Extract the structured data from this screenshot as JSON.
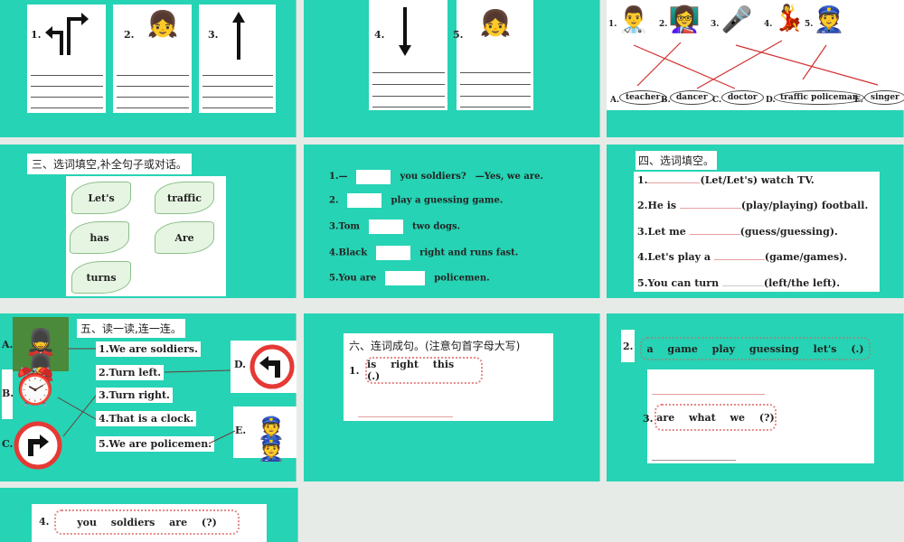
{
  "slide1": {
    "items": [
      {
        "num": "1.",
        "icon": "turn-arrows-icon"
      },
      {
        "num": "2.",
        "icon": "girl-waving-icon"
      },
      {
        "num": "3.",
        "icon": "up-arrow-icon"
      }
    ]
  },
  "slide2": {
    "items": [
      {
        "num": "4.",
        "icon": "down-arrow-icon"
      },
      {
        "num": "5.",
        "icon": "girl-waving-icon"
      }
    ]
  },
  "slide3": {
    "people": [
      "1.",
      "2.",
      "3.",
      "4.",
      "5."
    ],
    "words": [
      {
        "l": "A.",
        "w": "teacher"
      },
      {
        "l": "B.",
        "w": "dancer"
      },
      {
        "l": "C.",
        "w": "doctor"
      },
      {
        "l": "D.",
        "w": "traffic policeman"
      },
      {
        "l": "E.",
        "w": "singer"
      }
    ],
    "line_color": "#d32f2f"
  },
  "slide4": {
    "title": "三、选词填空,补全句子或对话。",
    "words": [
      "Let's",
      "traffic",
      "has",
      "Are",
      "turns"
    ]
  },
  "slide5": {
    "sentences": [
      {
        "pre": "1.—",
        "post": "you soldiers?　—Yes, we are."
      },
      {
        "pre": "2.",
        "post": "play a guessing game."
      },
      {
        "pre": "3.Tom",
        "post": "two dogs."
      },
      {
        "pre": "4.Black",
        "post": "right and runs fast."
      },
      {
        "pre": "5.You are",
        "post": "policemen."
      }
    ]
  },
  "slide6": {
    "title": "四、选词填空。",
    "sentences": [
      {
        "pre": "1.",
        "post": "(Let/Let's) watch TV."
      },
      {
        "pre": "2.He is",
        "post": "(play/playing) football."
      },
      {
        "pre": "3.Let me",
        "post": "(guess/guessing)."
      },
      {
        "pre": "4.Let's play a",
        "post": "(game/games)."
      },
      {
        "pre": "5.You can turn",
        "post": "(left/the left)."
      }
    ]
  },
  "slide7": {
    "title": "五、读一读,连一连。",
    "sentences": [
      "1.We are soldiers.",
      "2.Turn left.",
      "3.Turn right.",
      "4.That is a clock.",
      "5.We are policemen."
    ],
    "pics": [
      "A.",
      "B.",
      "C.",
      "D.",
      "E."
    ],
    "sign_color": "#e53935"
  },
  "slide8": {
    "title": "六、连词成句。(注意句首字母大写)",
    "q1_num": "1.",
    "q1": "is right this (.)"
  },
  "slide9": {
    "q2_num": "2.",
    "q2": "a game play guessing let's (.)",
    "q3_num": "3.",
    "q3": "are what we (?)"
  },
  "slide10": {
    "q4_num": "4.",
    "q4": "you soldiers are (?)"
  },
  "colors": {
    "teal": "#26d3b4",
    "gap": "#e6ebe8"
  }
}
